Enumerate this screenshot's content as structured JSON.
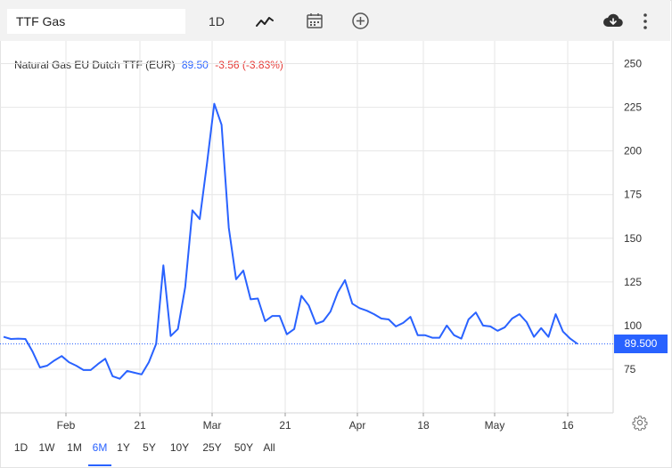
{
  "toolbar": {
    "symbol_value": "TTF Gas",
    "interval_label": "1D",
    "chart_type_icon": "line-chart-icon",
    "calendar_icon": "calendar-icon",
    "compare_icon": "plus-circle-icon",
    "download_icon": "cloud-download-icon",
    "menu_icon": "more-vertical-icon"
  },
  "legend": {
    "name": "Natural Gas EU Dutch TTF (EUR)",
    "price": "89.50",
    "change": "-3.56 (-3.83%)"
  },
  "last_price_label": "89.500",
  "colors": {
    "line": "#2962ff",
    "change_negative": "#e53935",
    "toolbar_bg": "#f2f2f2",
    "grid": "#e6e6e6"
  },
  "ranges": {
    "items": [
      "1D",
      "1W",
      "1M",
      "6M",
      "1Y",
      "5Y",
      "10Y",
      "25Y",
      "50Y",
      "All"
    ],
    "active": "6M"
  },
  "settings_icon": "gear-icon",
  "chart_data": {
    "type": "line",
    "title": "Natural Gas EU Dutch TTF (EUR)",
    "xlabel": "",
    "ylabel": "",
    "ylim": [
      50,
      263
    ],
    "y_ticks": [
      75,
      100,
      125,
      150,
      175,
      200,
      225,
      250
    ],
    "x_ticks": [
      "Feb",
      "21",
      "Mar",
      "21",
      "Apr",
      "18",
      "May",
      "16"
    ],
    "grid": true,
    "last_value": 89.5,
    "series": [
      {
        "values": [
          93.5,
          92.3,
          92.5,
          92.3,
          85.0,
          76.0,
          77.0,
          80.0,
          82.5,
          79.0,
          77.0,
          74.5,
          74.5,
          78.0,
          81.0,
          71.0,
          69.5,
          74.0,
          73.0,
          72.0,
          79.0,
          89.5,
          134.5,
          94.0,
          98.0,
          122.0,
          166.0,
          161.0,
          193.0,
          227.0,
          215.0,
          156.0,
          126.5,
          131.5,
          115.0,
          115.5,
          102.5,
          105.5,
          105.5,
          95.0,
          98.0,
          117.0,
          111.5,
          101.0,
          102.5,
          108.0,
          119.0,
          126.0,
          112.5,
          110.0,
          108.5,
          106.5,
          104.0,
          103.5,
          99.5,
          101.5,
          105.0,
          94.5,
          94.5,
          93.0,
          93.0,
          100.0,
          94.5,
          92.5,
          103.5,
          107.5,
          100.0,
          99.5,
          97.0,
          99.0,
          104.0,
          106.5,
          102.0,
          93.5,
          98.5,
          93.5,
          106.5,
          96.5,
          92.5,
          89.5
        ]
      }
    ]
  }
}
